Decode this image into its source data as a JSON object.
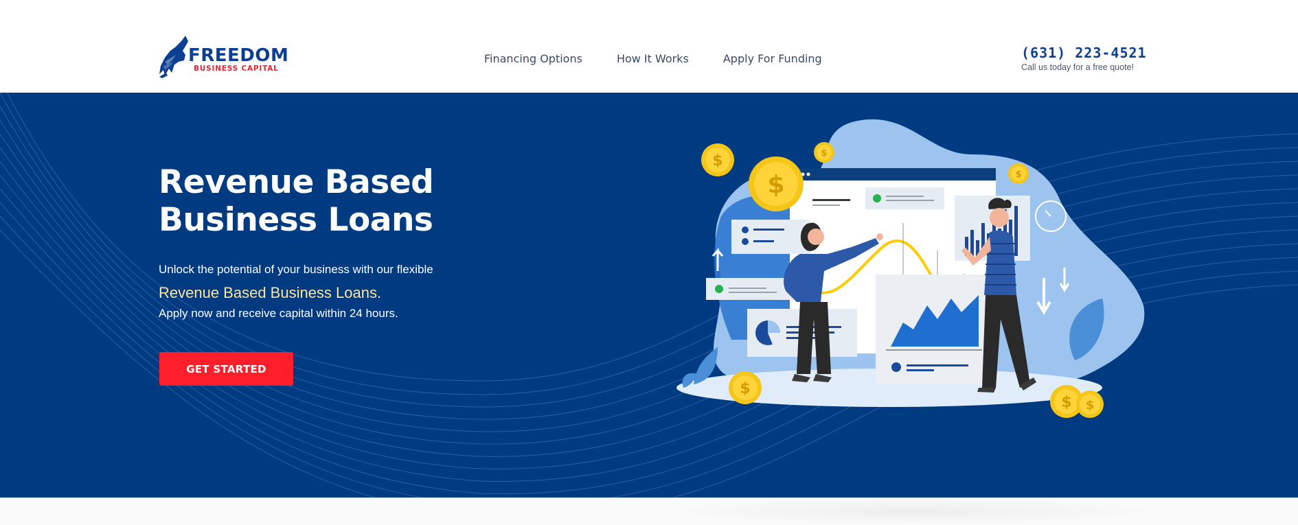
{
  "brand": {
    "name": "FREEDOM",
    "subtitle": "BUSINESS CAPITAL",
    "primary_color": "#0b3f93",
    "accent_color": "#e42534"
  },
  "nav": {
    "items": [
      {
        "label": "Financing Options"
      },
      {
        "label": "How It Works"
      },
      {
        "label": "Apply For Funding"
      }
    ]
  },
  "contact": {
    "phone": "(631) 223-4521",
    "note": "Call us today for a free quote!"
  },
  "hero": {
    "title_line1": "Revenue Based",
    "title_line2": "Business Loans",
    "text_line1": "Unlock the potential of your business with our flexible",
    "text_highlight": "Revenue Based Business Loans.",
    "text_line3": "Apply now and receive capital within 24 hours.",
    "cta_label": "GET STARTED",
    "background_color": "#003a80",
    "highlight_color": "#ffe59a",
    "cta_color": "#ff1f2b"
  },
  "illustration": {
    "coin_symbol": "$"
  }
}
